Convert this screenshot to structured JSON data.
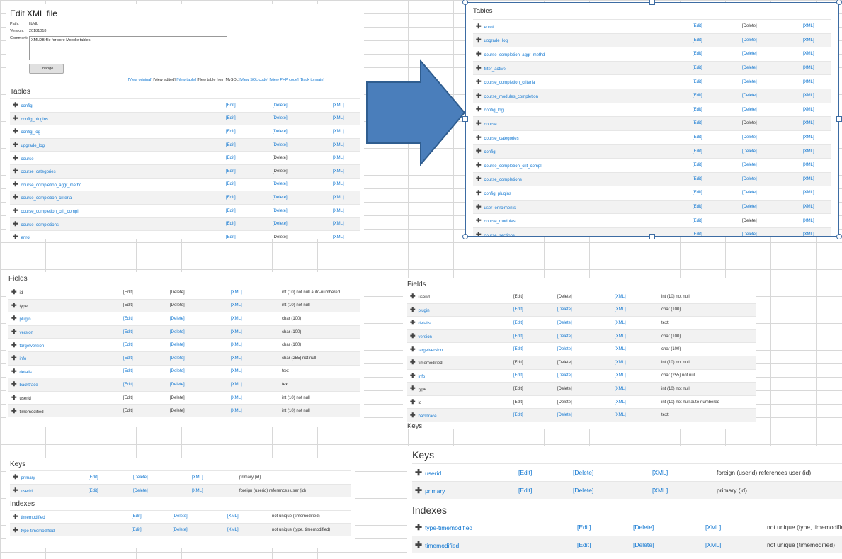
{
  "header": {
    "title": "Edit XML file",
    "path_label": "Path:",
    "path_value": "lib/db",
    "version_label": "Version:",
    "version_value": "20181018",
    "comment_label": "Comment:",
    "comment_value": "XMLDB file for core Moodle tables",
    "change_label": "Change",
    "links": {
      "view_original": "[View original]",
      "view_edited": "[View edited]",
      "new_table": "[New table]",
      "new_table_mysql": "[New table from MySQL]",
      "view_sql": "[View SQL code]",
      "view_php": "[View PHP code]",
      "back": "[Back to main]"
    }
  },
  "labels": {
    "tables": "Tables",
    "fields": "Fields",
    "keys": "Keys",
    "indexes": "Indexes",
    "keys_cut": "Keys",
    "edit": "[Edit]",
    "delete": "[Delete]",
    "xml": "[XML]"
  },
  "tables_before": [
    {
      "name": "config",
      "del": true
    },
    {
      "name": "config_plugins",
      "del": true
    },
    {
      "name": "config_log",
      "del": true
    },
    {
      "name": "upgrade_log",
      "del": true
    },
    {
      "name": "course",
      "del": false
    },
    {
      "name": "course_categories",
      "del": false
    },
    {
      "name": "course_completion_aggr_methd",
      "del": true
    },
    {
      "name": "course_completion_criteria",
      "del": true
    },
    {
      "name": "course_completion_crit_compl",
      "del": true
    },
    {
      "name": "course_completions",
      "del": true
    },
    {
      "name": "enrol",
      "del": false
    }
  ],
  "tables_after": [
    {
      "name": "enrol",
      "del": false
    },
    {
      "name": "upgrade_log",
      "del": true
    },
    {
      "name": "course_completion_aggr_methd",
      "del": true
    },
    {
      "name": "filter_active",
      "del": true
    },
    {
      "name": "course_completion_criteria",
      "del": true
    },
    {
      "name": "course_modules_completion",
      "del": true
    },
    {
      "name": "config_log",
      "del": true
    },
    {
      "name": "course",
      "del": false
    },
    {
      "name": "course_categories",
      "del": true
    },
    {
      "name": "config",
      "del": true
    },
    {
      "name": "course_completion_crit_compl",
      "del": true
    },
    {
      "name": "course_completions",
      "del": true
    },
    {
      "name": "config_plugins",
      "del": true
    },
    {
      "name": "user_enrolments",
      "del": true
    },
    {
      "name": "course_modules",
      "del": false
    },
    {
      "name": "course_sections",
      "del": true
    }
  ],
  "fields_before": [
    {
      "name": "id",
      "link": false,
      "edit": false,
      "del": false,
      "type": "int (10) not null auto-numbered"
    },
    {
      "name": "type",
      "link": false,
      "edit": false,
      "del": false,
      "type": "int (10) not null"
    },
    {
      "name": "plugin",
      "link": true,
      "edit": true,
      "del": true,
      "type": "char (100)"
    },
    {
      "name": "version",
      "link": true,
      "edit": true,
      "del": true,
      "type": "char (100)"
    },
    {
      "name": "targetversion",
      "link": true,
      "edit": true,
      "del": true,
      "type": "char (100)"
    },
    {
      "name": "info",
      "link": true,
      "edit": true,
      "del": true,
      "type": "char (255) not null"
    },
    {
      "name": "details",
      "link": true,
      "edit": true,
      "del": true,
      "type": "text"
    },
    {
      "name": "backtrace",
      "link": true,
      "edit": true,
      "del": true,
      "type": "text"
    },
    {
      "name": "userid",
      "link": false,
      "edit": false,
      "del": false,
      "type": "int (10) not null"
    },
    {
      "name": "timemodified",
      "link": false,
      "edit": false,
      "del": false,
      "type": "int (10) not null"
    }
  ],
  "fields_after": [
    {
      "name": "userid",
      "link": false,
      "edit": false,
      "del": false,
      "type": "int (10) not null"
    },
    {
      "name": "plugin",
      "link": true,
      "edit": true,
      "del": true,
      "type": "char (100)"
    },
    {
      "name": "details",
      "link": true,
      "edit": true,
      "del": true,
      "type": "text"
    },
    {
      "name": "version",
      "link": true,
      "edit": true,
      "del": true,
      "type": "char (100)"
    },
    {
      "name": "targetversion",
      "link": true,
      "edit": true,
      "del": true,
      "type": "char (100)"
    },
    {
      "name": "timemodified",
      "link": false,
      "edit": false,
      "del": false,
      "type": "int (10) not null"
    },
    {
      "name": "info",
      "link": true,
      "edit": true,
      "del": true,
      "type": "char (255) not null"
    },
    {
      "name": "type",
      "link": false,
      "edit": false,
      "del": false,
      "type": "int (10) not null"
    },
    {
      "name": "id",
      "link": false,
      "edit": false,
      "del": false,
      "type": "int (10) not null auto-numbered"
    },
    {
      "name": "backtrace",
      "link": true,
      "edit": true,
      "del": true,
      "type": "text"
    }
  ],
  "keys_before": [
    {
      "name": "primary",
      "desc": "primary (id)"
    },
    {
      "name": "userid",
      "desc": "foreign (userid) references user (id)"
    }
  ],
  "indexes_before": [
    {
      "name": "timemodified",
      "desc": "not unique (timemodified)"
    },
    {
      "name": "type-timemodified",
      "desc": "not unique (type, timemodified)"
    }
  ],
  "keys_after": [
    {
      "name": "userid",
      "desc": "foreign (userid) references user (id)"
    },
    {
      "name": "primary",
      "desc": "primary (id)"
    }
  ],
  "indexes_after": [
    {
      "name": "type-timemodified",
      "desc": "not unique (type, timemodified)"
    },
    {
      "name": "timemodified",
      "desc": "not unique (timemodified)"
    }
  ],
  "colors": {
    "link": "#1177d1",
    "arrow_fill": "#4a7ebb",
    "arrow_stroke": "#2f5d8f",
    "selection": "#3d6ca3"
  }
}
